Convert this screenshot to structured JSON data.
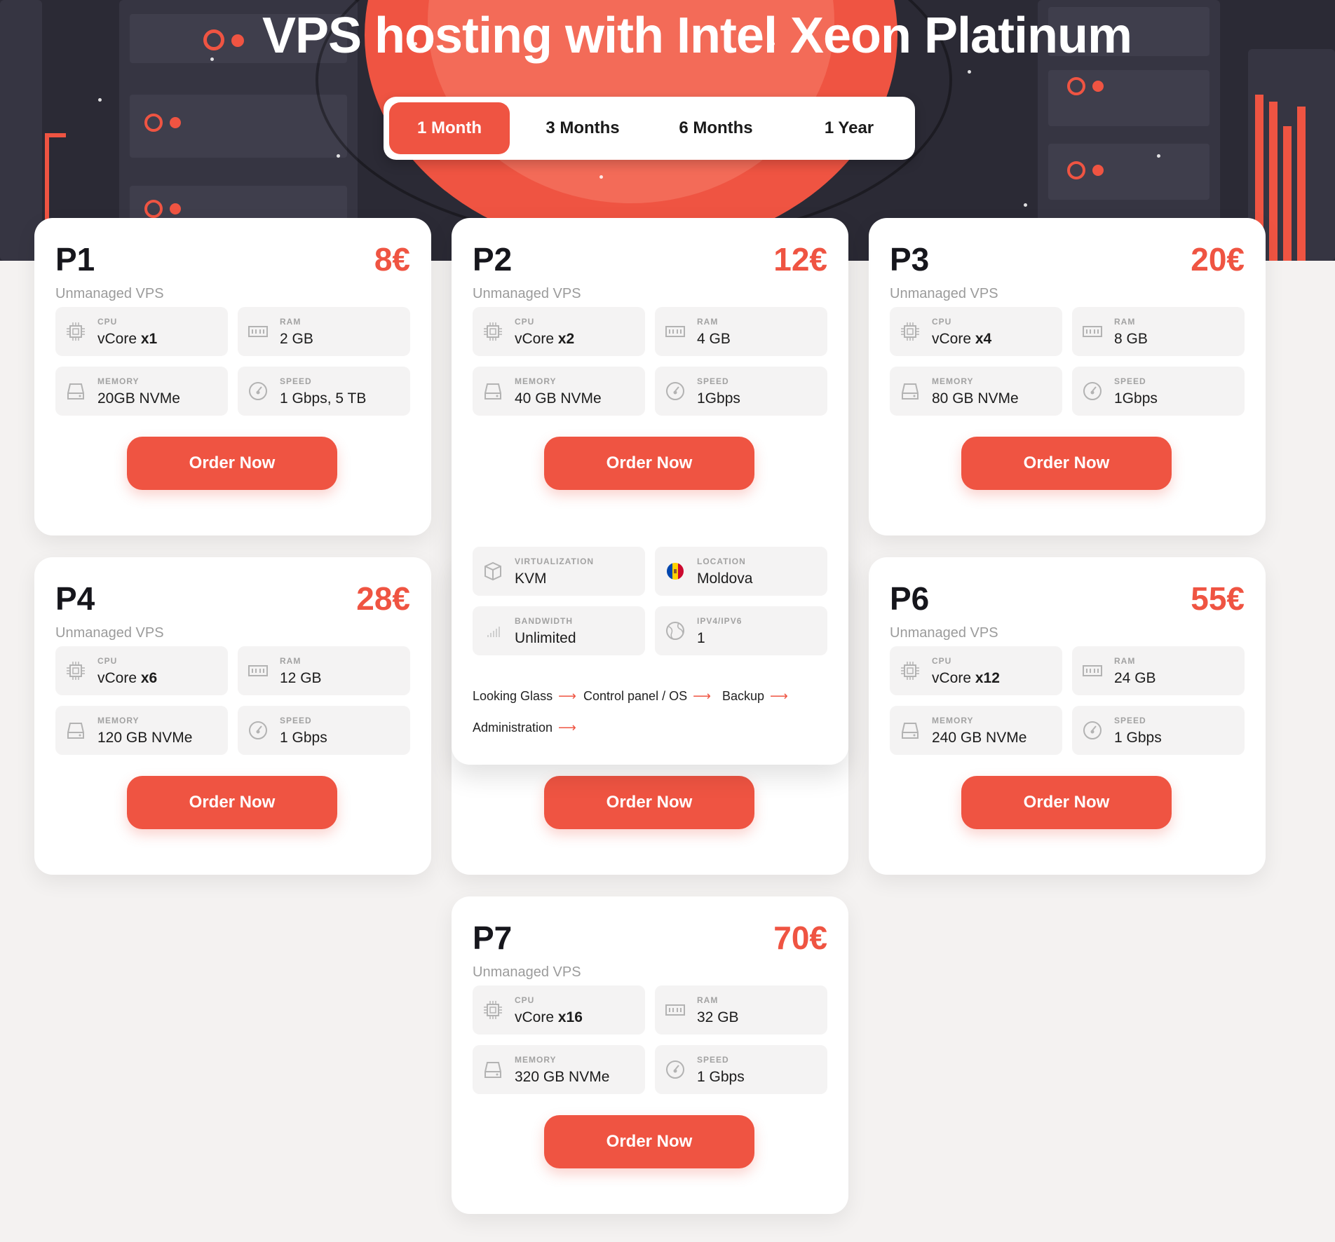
{
  "header": {
    "title": "VPS hosting with Intel Xeon Platinum"
  },
  "period_tabs": [
    {
      "label": "1 Month",
      "active": true
    },
    {
      "label": "3 Months",
      "active": false
    },
    {
      "label": "6 Months",
      "active": false
    },
    {
      "label": "1 Year",
      "active": false
    }
  ],
  "plans": [
    {
      "name": "P1",
      "price": "8€",
      "type": "Unmanaged VPS",
      "cpu": {
        "label": "CPU",
        "value": "vCore",
        "count": "x1"
      },
      "ram": {
        "label": "RAM",
        "value": "2 GB"
      },
      "memory": {
        "label": "MEMORY",
        "value": "20GB NVMe"
      },
      "speed": {
        "label": "SPEED",
        "value": "1 Gbps, 5 TB"
      },
      "order_label": "Order Now"
    },
    {
      "name": "P2",
      "price": "12€",
      "type": "Unmanaged VPS",
      "cpu": {
        "label": "CPU",
        "value": "vCore",
        "count": "x2"
      },
      "ram": {
        "label": "RAM",
        "value": "4 GB"
      },
      "memory": {
        "label": "MEMORY",
        "value": "40 GB NVMe"
      },
      "speed": {
        "label": "SPEED",
        "value": "1Gbps"
      },
      "order_label": "Order Now"
    },
    {
      "name": "P3",
      "price": "20€",
      "type": "Unmanaged VPS",
      "cpu": {
        "label": "CPU",
        "value": "vCore",
        "count": "x4"
      },
      "ram": {
        "label": "RAM",
        "value": "8 GB"
      },
      "memory": {
        "label": "MEMORY",
        "value": "80 GB NVMe"
      },
      "speed": {
        "label": "SPEED",
        "value": "1Gbps"
      },
      "order_label": "Order Now"
    },
    {
      "name": "P4",
      "price": "28€",
      "type": "Unmanaged VPS",
      "cpu": {
        "label": "CPU",
        "value": "vCore",
        "count": "x6"
      },
      "ram": {
        "label": "RAM",
        "value": "12 GB"
      },
      "memory": {
        "label": "MEMORY",
        "value": "120 GB NVMe"
      },
      "speed": {
        "label": "SPEED",
        "value": "1 Gbps"
      },
      "order_label": "Order Now"
    },
    {
      "name": "P6",
      "price": "55€",
      "type": "Unmanaged VPS",
      "cpu": {
        "label": "CPU",
        "value": "vCore",
        "count": "x12"
      },
      "ram": {
        "label": "RAM",
        "value": "24 GB"
      },
      "memory": {
        "label": "MEMORY",
        "value": "240 GB NVMe"
      },
      "speed": {
        "label": "SPEED",
        "value": "1 Gbps"
      },
      "order_label": "Order Now"
    },
    {
      "name": "P7",
      "price": "70€",
      "type": "Unmanaged VPS",
      "cpu": {
        "label": "CPU",
        "value": "vCore",
        "count": "x16"
      },
      "ram": {
        "label": "RAM",
        "value": "32 GB"
      },
      "memory": {
        "label": "MEMORY",
        "value": "320 GB NVMe"
      },
      "speed": {
        "label": "SPEED",
        "value": "1 Gbps"
      },
      "order_label": "Order Now"
    }
  ],
  "p2_expanded": {
    "virtualization": {
      "label": "VIRTUALIZATION",
      "value": "KVM"
    },
    "location": {
      "label": "LOCATION",
      "value": "Moldova"
    },
    "bandwidth": {
      "label": "BANDWIDTH",
      "value": "Unlimited"
    },
    "ipv": {
      "label": "IPV4/IPV6",
      "value": "1"
    },
    "links": [
      "Looking Glass",
      "Control panel / OS",
      "Backup",
      "Administration"
    ],
    "link_arrow": "⟶"
  },
  "p5_order_label": "Order Now",
  "colors": {
    "accent": "#ef5442",
    "hero_bg": "#2b2a35",
    "page_bg": "#f4f2f1"
  }
}
